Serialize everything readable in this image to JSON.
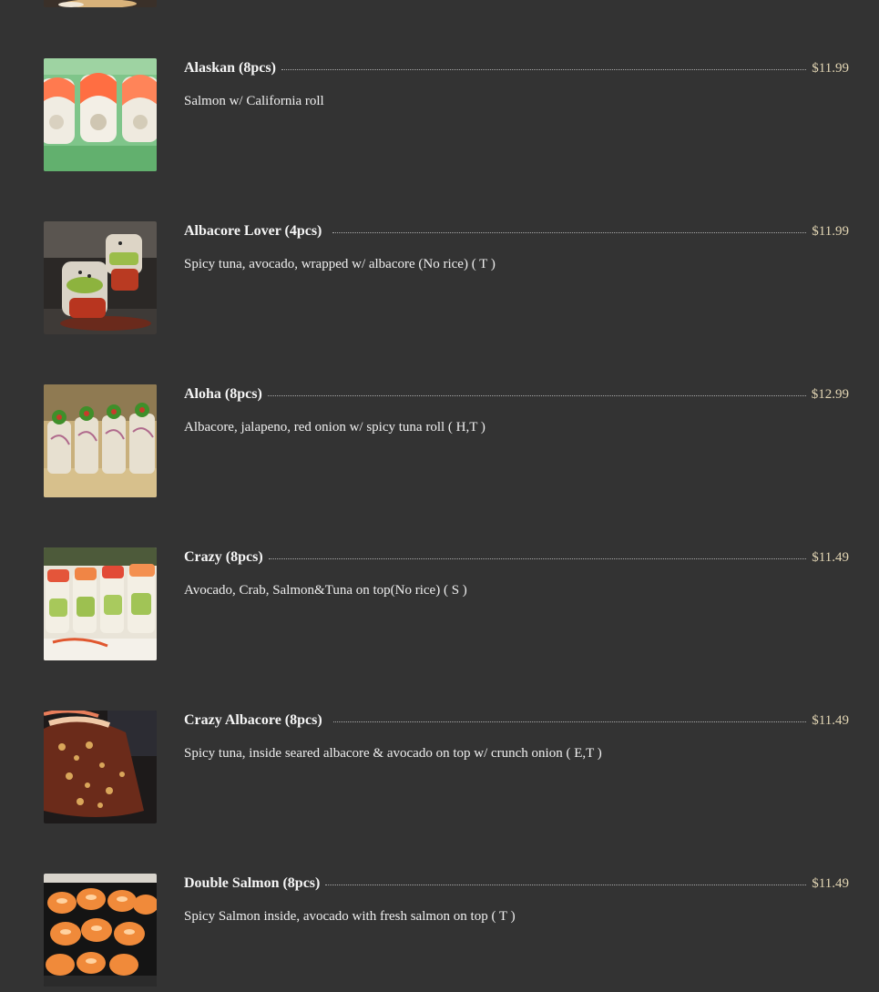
{
  "items": [
    {
      "name": "Alaskan (8pcs)",
      "price": "$11.99",
      "description": "Salmon w/ California roll",
      "image": "alaskan-roll-photo"
    },
    {
      "name": "Albacore Lover (4pcs)",
      "price": "$11.99",
      "description": "Spicy tuna, avocado, wrapped w/ albacore (No rice) ( T )",
      "image": "albacore-lover-photo"
    },
    {
      "name": "Aloha (8pcs)",
      "price": "$12.99",
      "description": "Albacore, jalapeno, red onion w/ spicy tuna roll ( H,T )",
      "image": "aloha-roll-photo"
    },
    {
      "name": "Crazy (8pcs)",
      "price": "$11.49",
      "description": "Avocado, Crab, Salmon&Tuna on top(No rice) ( S )",
      "image": "crazy-roll-photo"
    },
    {
      "name": "Crazy Albacore (8pcs)",
      "price": "$11.49",
      "description": "Spicy tuna, inside seared albacore & avocado on top w/ crunch onion ( E,T )",
      "image": "crazy-albacore-photo"
    },
    {
      "name": "Double Salmon (8pcs)",
      "price": "$11.49",
      "description": "Spicy Salmon inside, avocado with fresh salmon on top ( T )",
      "image": "double-salmon-photo"
    }
  ],
  "colors": {
    "background": "#333333",
    "price": "#e3d6b4",
    "text": "#f2f2f2"
  }
}
